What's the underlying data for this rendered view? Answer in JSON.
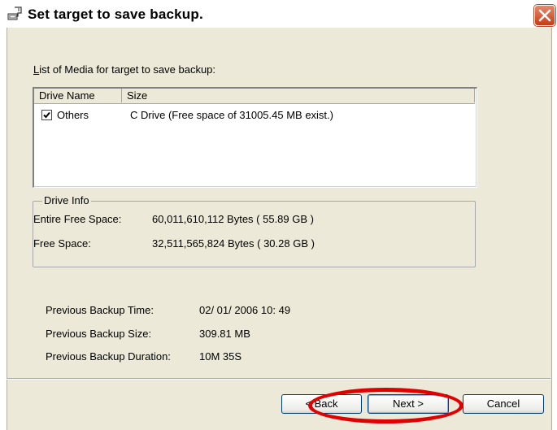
{
  "window": {
    "title": "Set target to save backup."
  },
  "media_list": {
    "label": "List of Media for target to save backup:",
    "columns": [
      "Drive Name",
      "Size"
    ],
    "rows": [
      {
        "checked": true,
        "drive_name": "Others",
        "size": "C Drive (Free space of 31005.45 MB exist.)"
      }
    ]
  },
  "drive_info": {
    "legend": "Drive Info",
    "entire_free_space_label": "Entire Free Space:",
    "entire_free_space_value": "60,011,610,112 Bytes ( 55.89 GB )",
    "free_space_label": "Free Space:",
    "free_space_value": "32,511,565,824 Bytes ( 30.28 GB )"
  },
  "previous_backup": {
    "time_label": "Previous Backup Time:",
    "time_value": "02/ 01/ 2006  10: 49",
    "size_label": "Previous Backup Size:",
    "size_value": "309.81 MB",
    "duration_label": "Previous Backup Duration:",
    "duration_value": "10M 35S"
  },
  "buttons": {
    "back": "< Back",
    "next": "Next >",
    "cancel": "Cancel"
  },
  "colors": {
    "highlight": "#e00000",
    "close_button": "#c83c12",
    "dialog_background": "#ece9d8"
  }
}
